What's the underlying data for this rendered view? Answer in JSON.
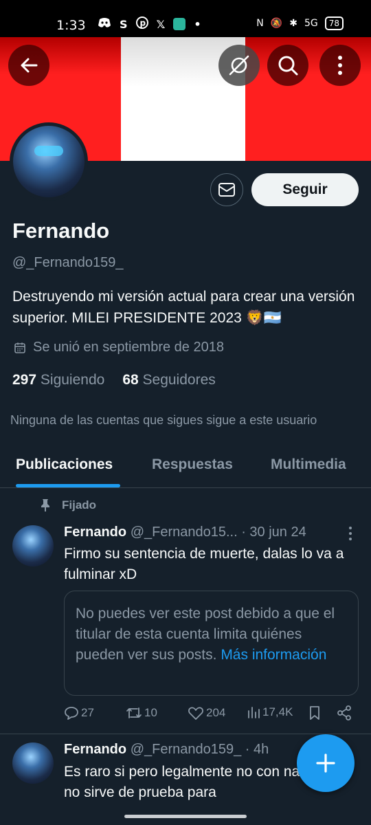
{
  "status_bar": {
    "time": "1:33",
    "battery": "78",
    "network": "5G"
  },
  "profile": {
    "name": "Fernando",
    "handle": "@_Fernando159_",
    "bio": "Destruyendo mi versión actual para crear una versión superior. MILEI PRESIDENTE 2023 🦁🇦🇷",
    "joined": "Se unió en septiembre de 2018",
    "following_count": "297",
    "following_label": "Siguiendo",
    "followers_count": "68",
    "followers_label": "Seguidores",
    "followed_by_note": "Ninguna de las cuentas que sigues sigue a este usuario",
    "follow_button": "Seguir"
  },
  "tabs": [
    {
      "label": "Publicaciones",
      "active": true
    },
    {
      "label": "Respuestas",
      "active": false
    },
    {
      "label": "Multimedia",
      "active": false
    }
  ],
  "pinned_label": "Fijado",
  "posts": [
    {
      "name": "Fernando",
      "handle": "@_Fernando15...",
      "time": "· 30 jun 24",
      "text": "Firmo su sentencia de muerte, dalas lo va a fulminar xD",
      "restricted": {
        "text": "No puedes ver este post debido a que el titular de esta cuenta limita quiénes pueden ver sus posts.",
        "link": "Más información"
      },
      "replies": "27",
      "reposts": "10",
      "likes": "204",
      "views": "17,4K"
    },
    {
      "name": "Fernando",
      "handle": "@_Fernando159_",
      "time": "· 4h",
      "text": "Es raro si pero legalmente no con nada, esto no sirve de prueba para"
    }
  ],
  "colors": {
    "background": "#15202b",
    "accent": "#1d9bf0",
    "banner_red": "#ff1f1f",
    "muted_text": "#8b98a5"
  }
}
